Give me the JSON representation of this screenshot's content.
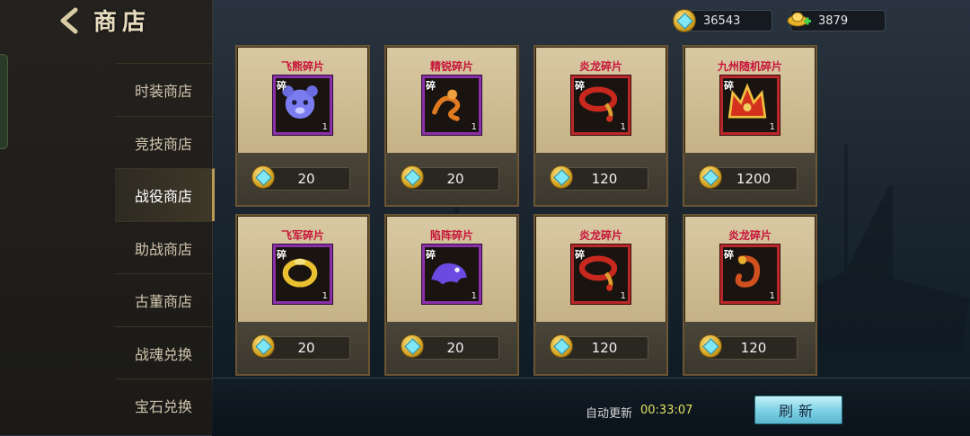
{
  "header": {
    "title": "商店"
  },
  "currencies": [
    {
      "icon": "diamond-coin-icon",
      "value": "36543"
    },
    {
      "icon": "gold-ingot-icon",
      "value": "3879"
    }
  ],
  "sidebar": {
    "items": [
      {
        "label": "时装商店",
        "active": false
      },
      {
        "label": "竞技商店",
        "active": false
      },
      {
        "label": "战役商店",
        "active": true
      },
      {
        "label": "助战商店",
        "active": false
      },
      {
        "label": "古董商店",
        "active": false
      },
      {
        "label": "战魂兑换",
        "active": false
      },
      {
        "label": "宝石兑换",
        "active": false
      }
    ]
  },
  "shop": {
    "items": [
      {
        "name": "飞熊碎片",
        "tag": "碎",
        "qty": "1",
        "price": "20",
        "icon": "bear-fragment-icon",
        "frame": "#8a2fa8"
      },
      {
        "name": "精锐碎片",
        "tag": "碎",
        "qty": "1",
        "price": "20",
        "icon": "serpent-fragment-icon",
        "frame": "#8a2fa8"
      },
      {
        "name": "炎龙碎片",
        "tag": "碎",
        "qty": "1",
        "price": "120",
        "icon": "dragon-bracelet-fragment-icon",
        "frame": "#b8282a"
      },
      {
        "name": "九州随机碎片",
        "tag": "碎",
        "qty": "1",
        "price": "1200",
        "icon": "crown-fragment-icon",
        "frame": "#b8282a"
      },
      {
        "name": "飞军碎片",
        "tag": "碎",
        "qty": "1",
        "price": "20",
        "icon": "gold-ring-fragment-icon",
        "frame": "#8a2fa8"
      },
      {
        "name": "陷阵碎片",
        "tag": "碎",
        "qty": "1",
        "price": "20",
        "icon": "beast-fragment-icon",
        "frame": "#8a2fa8"
      },
      {
        "name": "炎龙碎片",
        "tag": "碎",
        "qty": "1",
        "price": "120",
        "icon": "dragon-bracelet-fragment-icon",
        "frame": "#b8282a"
      },
      {
        "name": "炎龙碎片",
        "tag": "碎",
        "qty": "1",
        "price": "120",
        "icon": "dragon-hook-fragment-icon",
        "frame": "#b8282a"
      }
    ]
  },
  "footer": {
    "auto_refresh_label": "自动更新",
    "timer": "00:33:07",
    "refresh_label": "刷新"
  }
}
